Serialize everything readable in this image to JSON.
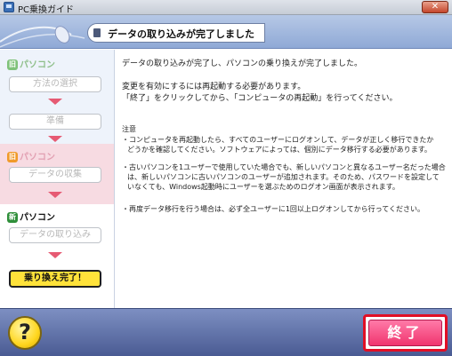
{
  "window": {
    "title": "PC乗換ガイド",
    "close_label": "✕"
  },
  "header": {
    "title": "データの取り込みが完了しました"
  },
  "sidebar": {
    "old_pc": {
      "badge": "旧",
      "label": "パソコン"
    },
    "mid_pc": {
      "badge": "旧",
      "label": "パソコン"
    },
    "new_pc": {
      "badge": "新",
      "label": "パソコン"
    },
    "steps": [
      "方法の選択",
      "準備",
      "データの収集",
      "データの取り込み"
    ],
    "final": "乗り換え完了！"
  },
  "content": {
    "line1": "データの取り込みが完了し、パソコンの乗り換えが完了しました。",
    "line2": "変更を有効にするには再起動する必要があります。",
    "line3": "「終了」をクリックしてから、「コンピュータの再起動」を行ってください。",
    "note_title": "注意",
    "note1a": "・コンピュータを再起動したら、すべてのユーザーにログオンして、データが正しく移行できたか",
    "note1b": "どうかを確認してください。ソフトウェアによっては、個別にデータ移行する必要があります。",
    "note2a": "・古いパソコンを1ユーザーで使用していた場合でも、新しいパソコンと異なるユーザー名だった場合",
    "note2b": "は、新しいパソコンに古いパソコンのユーザーが追加されます。そのため、パスワードを設定して",
    "note2c": "いなくても、Windows起動時にユーザーを選ぶためのログオン画面が表示されます。",
    "note3": "・再度データ移行を行う場合は、必ず全ユーザーに1回以上ログオンしてから行ってください。"
  },
  "footer": {
    "help": "?",
    "finish": "終了"
  },
  "colors": {
    "accent_pink": "#f0356f",
    "arrow": "#e65a73",
    "final_yellow": "#ffe23a",
    "highlight_red": "#e10f25",
    "old_badge": "#7fc27a",
    "mid_badge": "#f09a2a",
    "new_badge": "#2f8f3a"
  }
}
